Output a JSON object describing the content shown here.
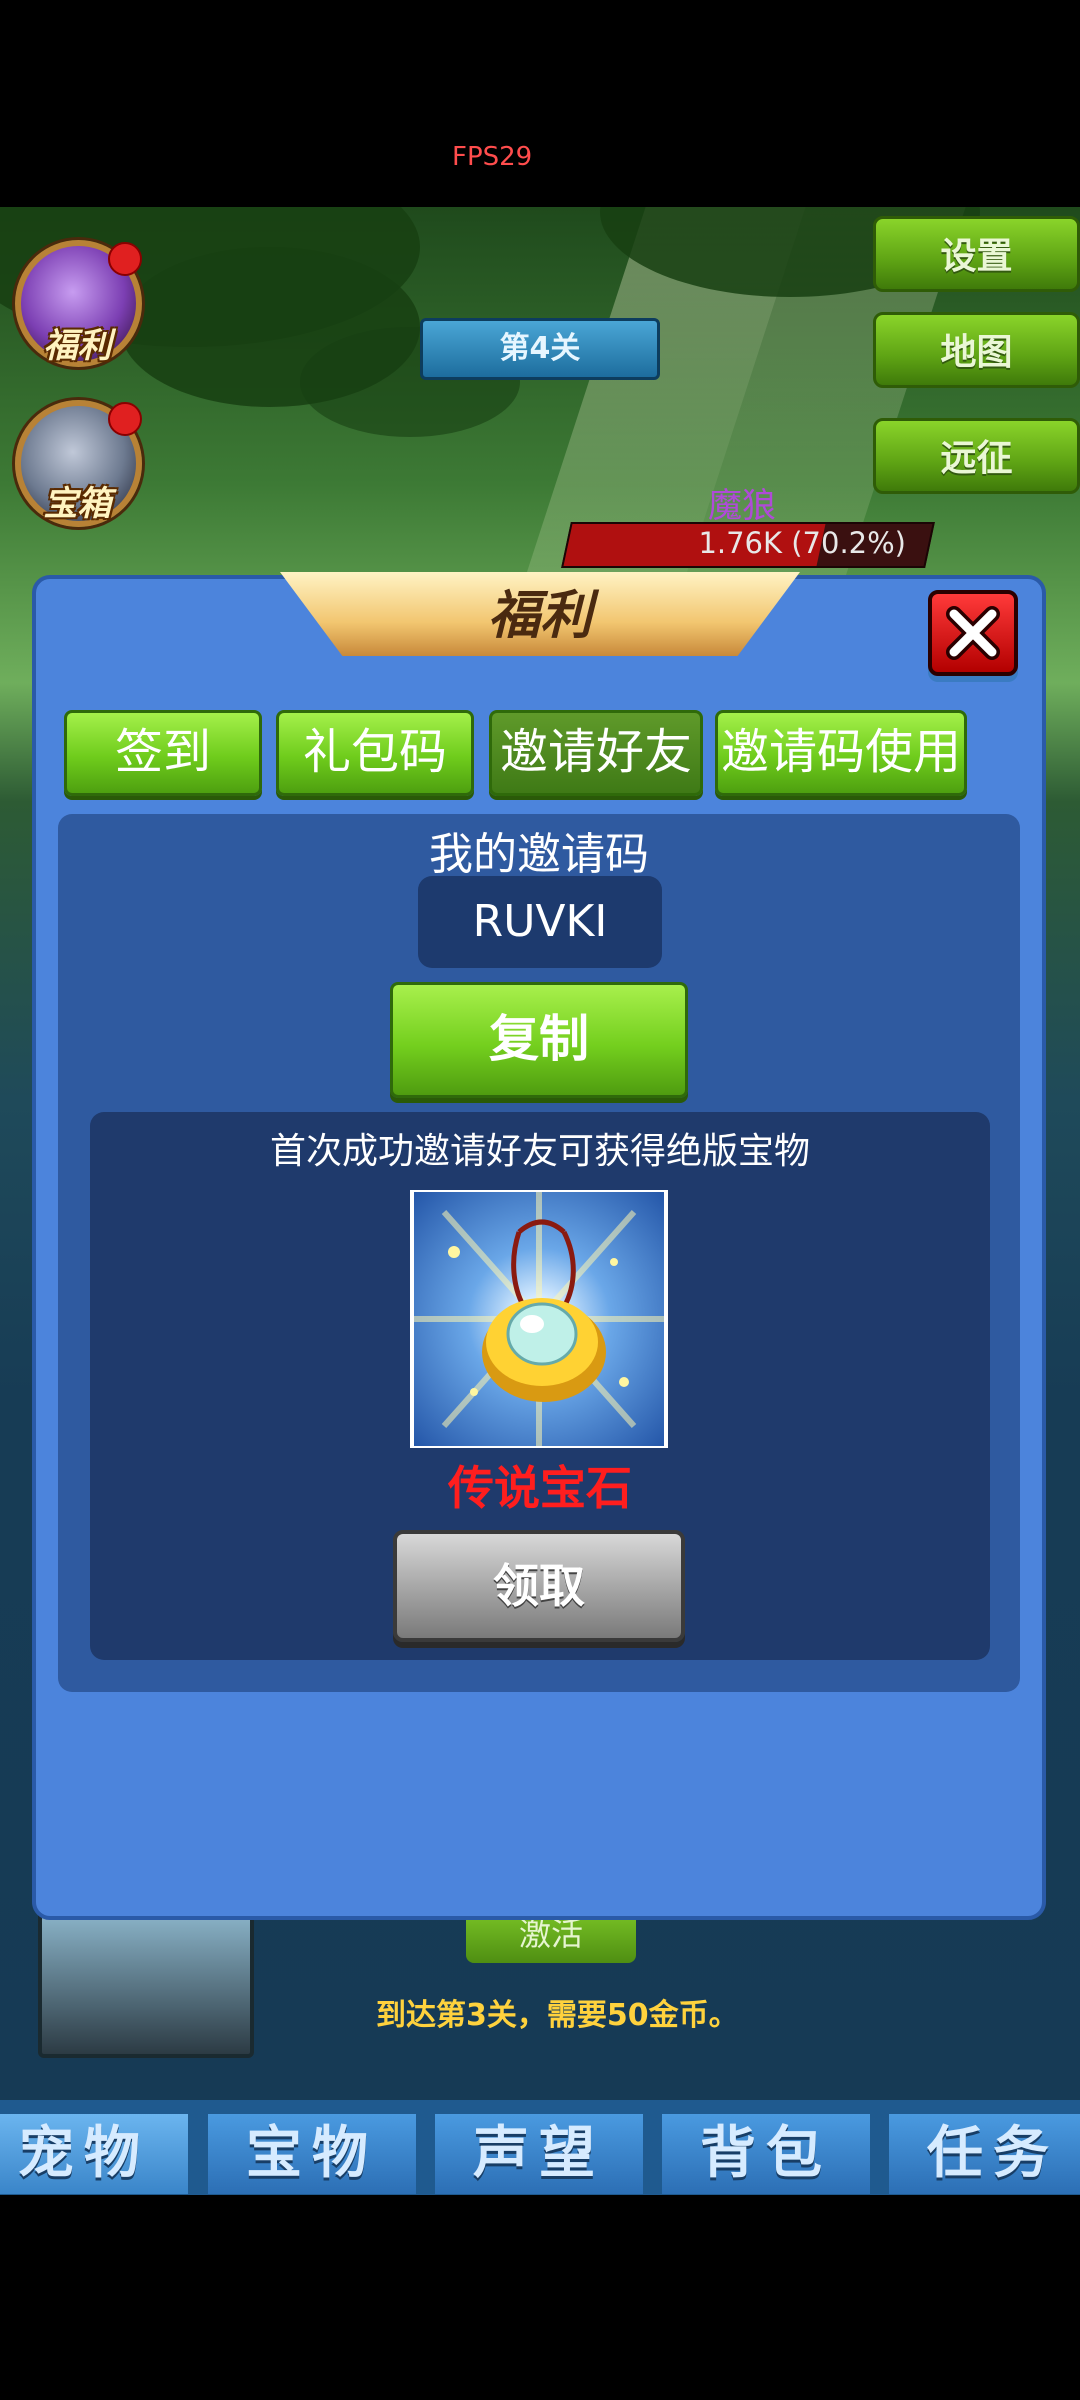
{
  "hud": {
    "fps": "FPS29",
    "stage": "第4关",
    "enemy": {
      "name": "魔狼",
      "hp_text": "1.76K (70.2%)",
      "hp_fraction": 0.702
    }
  },
  "side_icons": [
    {
      "label": "福利",
      "icon": "gift-icon",
      "has_badge": true
    },
    {
      "label": "宝箱",
      "icon": "treasure-chest-icon",
      "has_badge": true
    }
  ],
  "right_menu": [
    "设置",
    "地图",
    "远征"
  ],
  "background": {
    "activate_label": "激活",
    "requirement": "到达第3关，需要50金币。"
  },
  "bottom_tabs": [
    "宠物",
    "宝物",
    "声望",
    "背包",
    "任务"
  ],
  "dialog": {
    "title": "福利",
    "tabs": [
      {
        "label": "签到",
        "active": false
      },
      {
        "label": "礼包码",
        "active": false
      },
      {
        "label": "邀请好友",
        "active": true
      },
      {
        "label": "邀请码使用",
        "active": false
      }
    ],
    "invite_heading": "我的邀请码",
    "invite_code": "RUVKI",
    "copy_label": "复制",
    "reward_desc": "首次成功邀请好友可获得绝版宝物",
    "reward_item": {
      "name": "传说宝石",
      "icon": "legendary-gem-amulet-icon"
    },
    "claim_label": "领取"
  },
  "colors": {
    "dialog_bg": "#4c84dc",
    "tab_green": "#6fcc1c",
    "item_name_red": "#ff1e1e",
    "fps_red": "#ff4d4d"
  }
}
